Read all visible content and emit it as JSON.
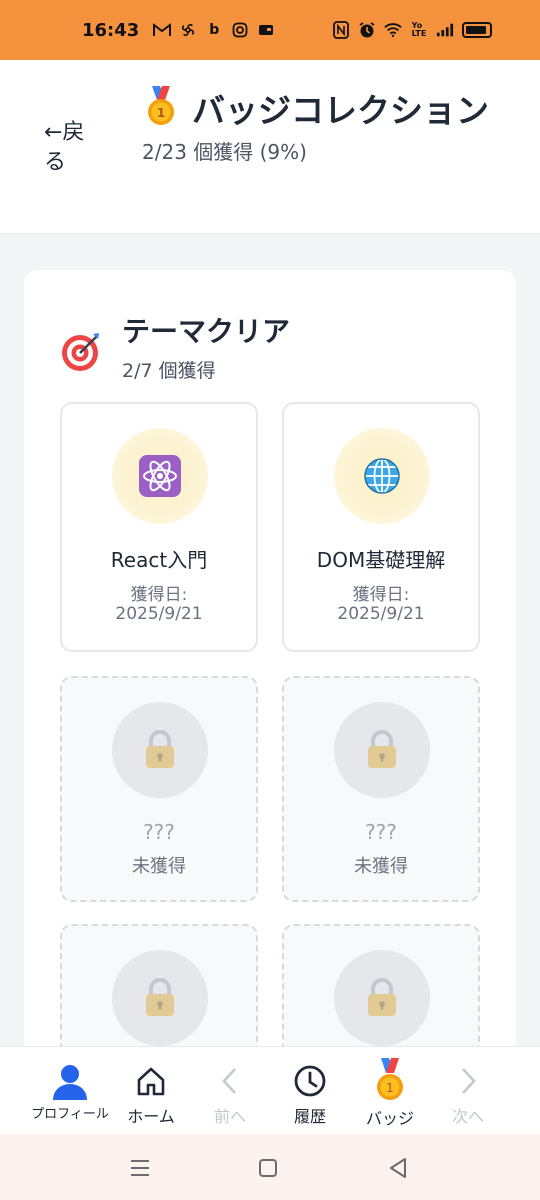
{
  "status_bar": {
    "time": "16:43",
    "left_icons": [
      "gmail-icon",
      "pinwheel-icon",
      "b-icon",
      "instagram-icon",
      "card-icon"
    ],
    "right_icons": [
      "nfc-icon",
      "alarm-icon",
      "wifi-icon",
      "volte-icon",
      "signal-icon",
      "battery-icon"
    ]
  },
  "header": {
    "back_label": "←戻る",
    "title": "バッジコレクション",
    "subtitle": "2/23 個獲得 (9%)"
  },
  "section": {
    "title": "テーマクリア",
    "subtitle": "2/7 個獲得"
  },
  "badges": [
    {
      "name": "React入門",
      "date_label": "獲得日:",
      "date": "2025/9/21",
      "icon": "atom-icon"
    },
    {
      "name": "DOM基礎理解",
      "date_label": "獲得日:",
      "date": "2025/9/21",
      "icon": "globe-icon"
    },
    {
      "name": "???",
      "status": "未獲得",
      "icon": "lock-icon"
    },
    {
      "name": "???",
      "status": "未獲得",
      "icon": "lock-icon"
    },
    {
      "name": "",
      "status": "",
      "icon": "lock-icon"
    },
    {
      "name": "",
      "status": "",
      "icon": "lock-icon"
    }
  ],
  "bottom_nav": [
    {
      "label": "プロフィール",
      "icon": "profile-icon"
    },
    {
      "label": "ホーム",
      "icon": "home-icon"
    },
    {
      "label": "前へ",
      "icon": "chevron-left-icon"
    },
    {
      "label": "履歴",
      "icon": "clock-icon"
    },
    {
      "label": "バッジ",
      "icon": "medal-icon"
    },
    {
      "label": "次へ",
      "icon": "chevron-right-icon"
    }
  ],
  "colors": {
    "status_bar": "#f5923e",
    "background": "#f4f5f7",
    "text": "#1f2937",
    "muted": "#6b7280",
    "disabled": "#c4c8cf"
  }
}
